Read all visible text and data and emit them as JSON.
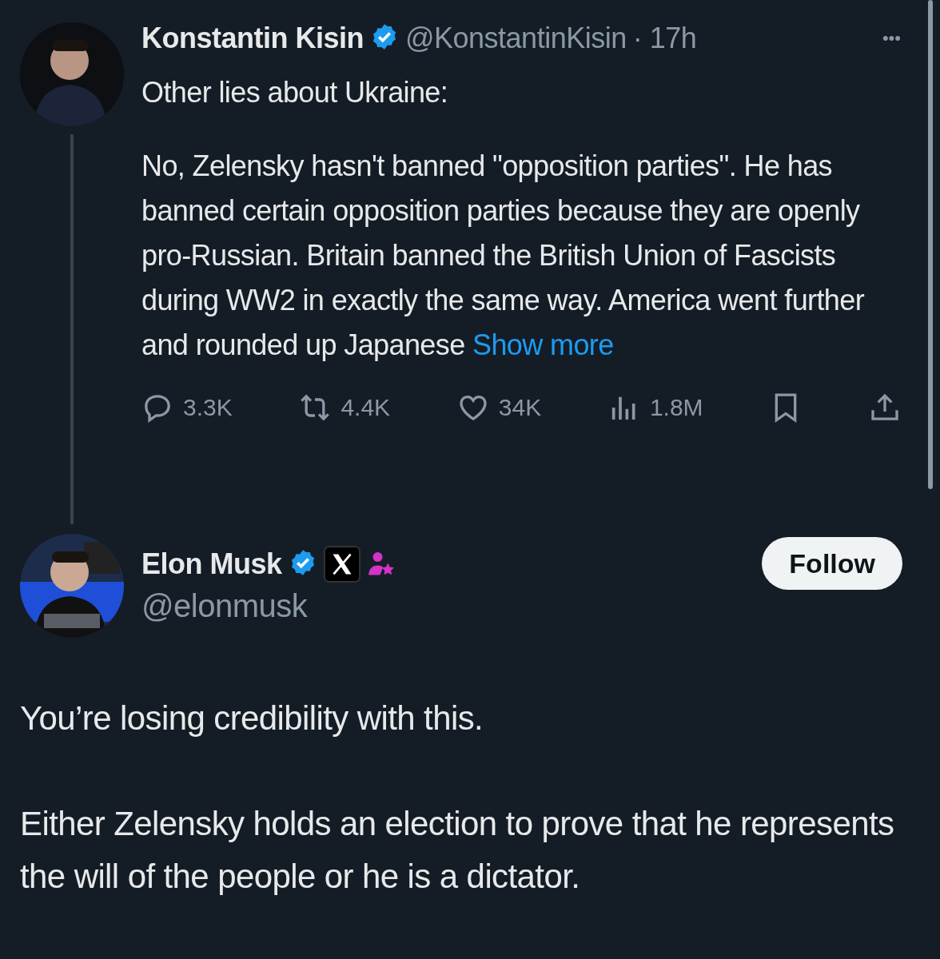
{
  "tweets": [
    {
      "name": "Konstantin Kisin",
      "verified": true,
      "handle": "@KonstantinKisin",
      "time": "· 17h",
      "paragraphs": [
        "Other lies about Ukraine:",
        "No, Zelensky hasn't banned \"opposition parties\". He has banned certain opposition parties because they are openly pro-Russian. Britain banned the British Union of Fascists during WW2 in exactly the same way. America went further and rounded up Japanese"
      ],
      "show_more": "Show more",
      "more_menu": "•••",
      "stats": [
        {
          "kind": "reply",
          "count": "3.3K"
        },
        {
          "kind": "repost",
          "count": "4.4K"
        },
        {
          "kind": "like",
          "count": "34K"
        },
        {
          "kind": "views",
          "count": "1.8M"
        },
        {
          "kind": "bookmark"
        },
        {
          "kind": "share"
        }
      ]
    },
    {
      "name": "Elon Musk",
      "verified": true,
      "affiliate": true,
      "subscriber_badge": true,
      "handle": "@elonmusk",
      "follow": "Follow",
      "paragraphs": [
        "You’re losing credibility with this.",
        "Either Zelensky holds an election to prove that he represents the will of the people or he is a dictator."
      ]
    }
  ]
}
